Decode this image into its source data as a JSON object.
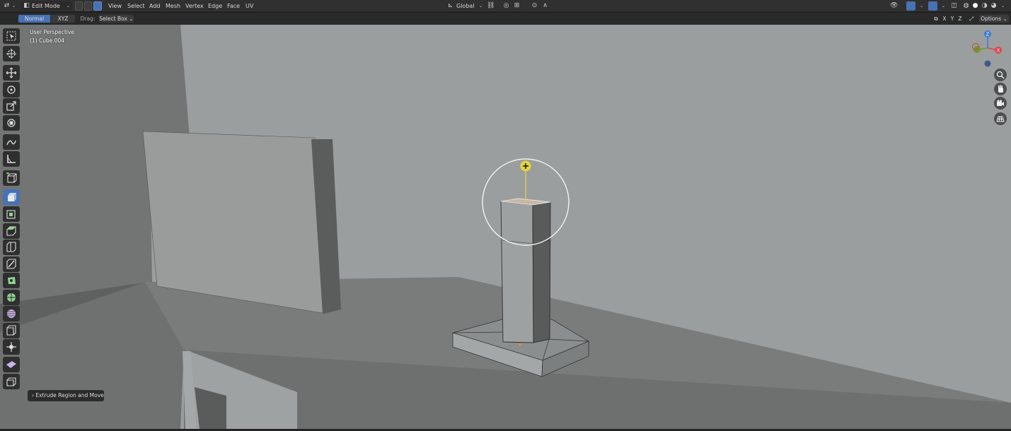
{
  "header": {
    "mode": "Edit Mode",
    "menus": [
      "View",
      "Select",
      "Add",
      "Mesh",
      "Vertex",
      "Edge",
      "Face",
      "UV"
    ],
    "transform_orientation": "Global",
    "options_label": "Options"
  },
  "tool_settings": {
    "orientation_options": [
      "Normal",
      "XYZ"
    ],
    "drag_label": "Drag:",
    "drag_value": "Select Box",
    "axis_labels": [
      "X",
      "Y",
      "Z"
    ]
  },
  "viewport": {
    "view_name": "User Perspective",
    "object_name": "(1) Cube.004",
    "gizmo_axes": [
      "Z",
      "X"
    ],
    "last_operator": "Extrude Region and Move"
  },
  "toolbar_tools": [
    "select-box-tool",
    "cursor-tool",
    "move-tool",
    "rotate-tool",
    "scale-tool",
    "transform-tool",
    "annotate-tool",
    "measure-tool",
    "add-cube-tool",
    "extrude-region-tool",
    "inset-faces-tool",
    "bevel-tool",
    "loop-cut-tool",
    "knife-tool",
    "poly-build-tool",
    "spin-tool",
    "smooth-tool",
    "edge-slide-tool",
    "shrink-fatten-tool",
    "shear-tool",
    "rip-region-tool"
  ],
  "colors": {
    "header": "#303030",
    "active_blue": "#4772b3",
    "viewport_bg": "#9a9d9d",
    "gizmo_yellow": "#e6d63a",
    "axis_x": "#e5414d",
    "axis_y": "#6e9a2e",
    "axis_z": "#3b7bd8"
  }
}
